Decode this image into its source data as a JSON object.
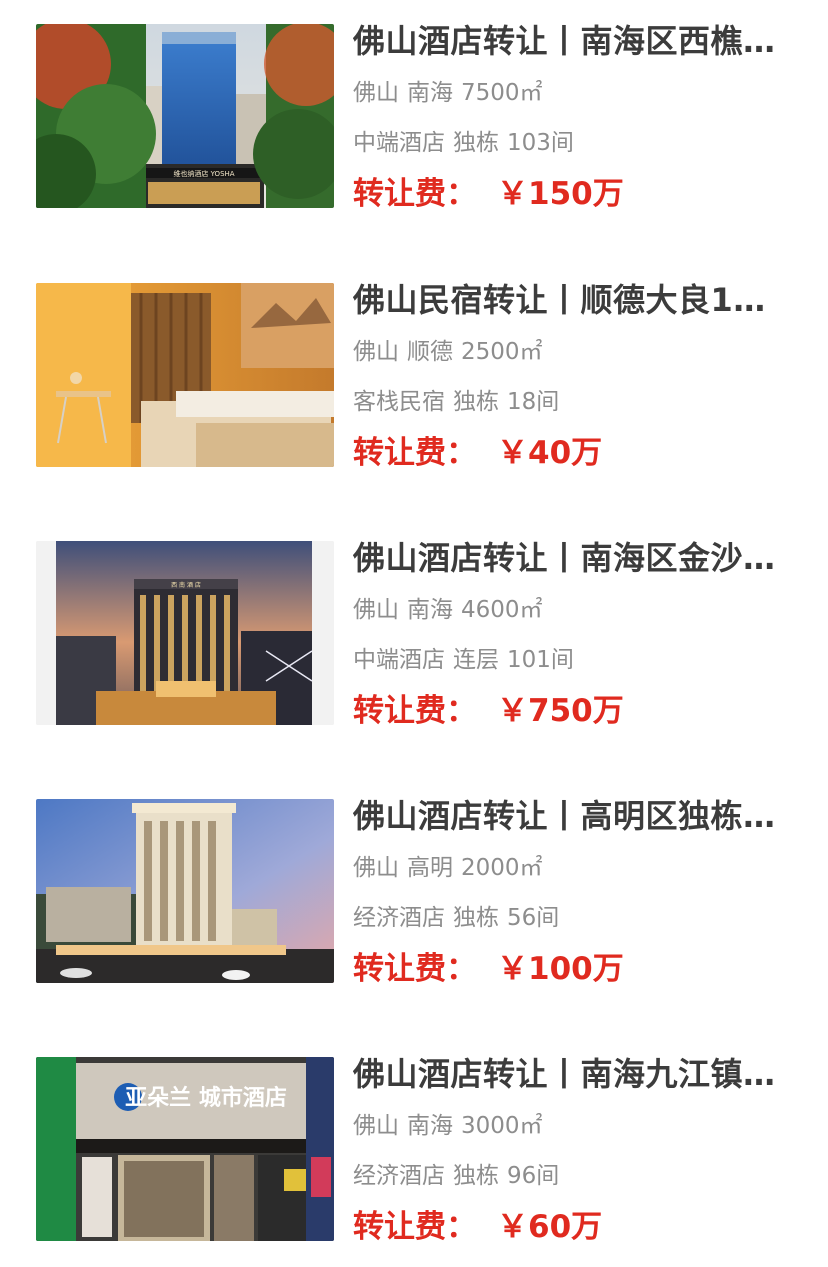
{
  "listings": [
    {
      "title": "佛山酒店转让丨南海区西樵…",
      "city": "佛山",
      "district": "南海",
      "area": "7500㎡",
      "category": "中端酒店",
      "building": "独栋",
      "rooms": "103间",
      "fee_label": "转让费：",
      "fee_value": "￥150万",
      "image_sign": "维也纳酒店 YOSHA"
    },
    {
      "title": "佛山民宿转让丨顺德大良1…",
      "city": "佛山",
      "district": "顺德",
      "area": "2500㎡",
      "category": "客栈民宿",
      "building": "独栋",
      "rooms": "18间",
      "fee_label": "转让费：",
      "fee_value": "￥40万",
      "image_sign": ""
    },
    {
      "title": "佛山酒店转让丨南海区金沙…",
      "city": "佛山",
      "district": "南海",
      "area": "4600㎡",
      "category": "中端酒店",
      "building": "连层",
      "rooms": "101间",
      "fee_label": "转让费：",
      "fee_value": "￥750万",
      "image_sign": "西 南 酒 店"
    },
    {
      "title": "佛山酒店转让丨高明区独栋…",
      "city": "佛山",
      "district": "高明",
      "area": "2000㎡",
      "category": "经济酒店",
      "building": "独栋",
      "rooms": "56间",
      "fee_label": "转让费：",
      "fee_value": "￥100万",
      "image_sign": ""
    },
    {
      "title": "佛山酒店转让丨南海九江镇…",
      "city": "佛山",
      "district": "南海",
      "area": "3000㎡",
      "category": "经济酒店",
      "building": "独栋",
      "rooms": "96间",
      "fee_label": "转让费：",
      "fee_value": "￥60万",
      "image_sign": "亚朵兰 城市酒店"
    }
  ]
}
